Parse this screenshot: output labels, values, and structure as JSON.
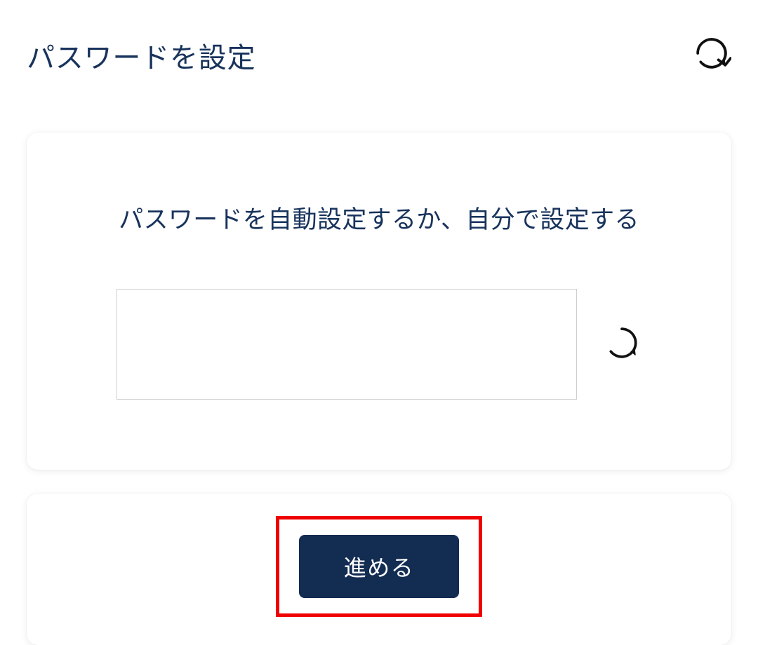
{
  "header": {
    "title": "パスワードを設定"
  },
  "main": {
    "instruction": "パスワードを自動設定するか、自分で設定する",
    "password_value": ""
  },
  "actions": {
    "proceed_label": "進める"
  },
  "icons": {
    "refresh_top": "refresh-icon",
    "refresh_inline": "refresh-icon"
  }
}
